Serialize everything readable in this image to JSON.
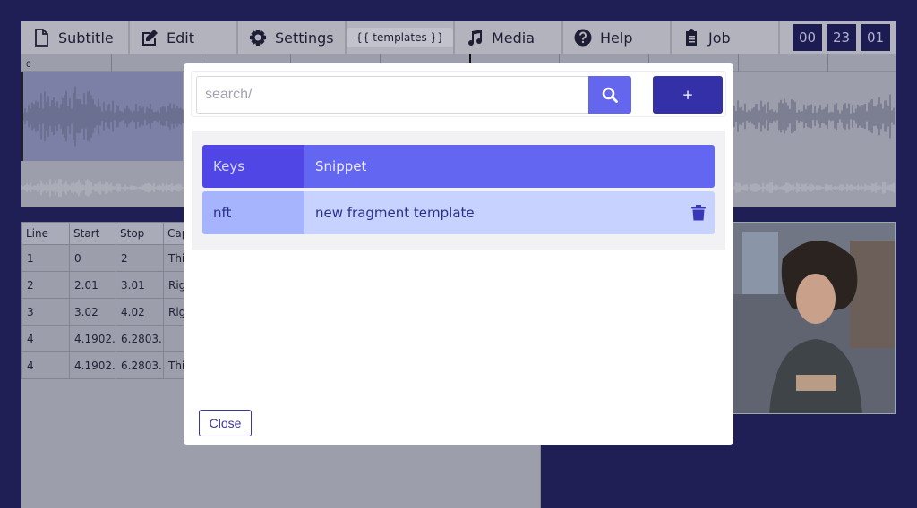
{
  "toolbar": {
    "subtitle": "Subtitle",
    "edit": "Edit",
    "settings": "Settings",
    "templates": "{{ templates }}",
    "media": "Media",
    "help": "Help",
    "job": "Job",
    "timer": [
      "00",
      "23",
      "01"
    ]
  },
  "waveform": {
    "ruler_start": "0"
  },
  "table": {
    "headers": [
      "Line",
      "Start",
      "Stop",
      "Cap"
    ],
    "rows": [
      [
        "1",
        "0",
        "2",
        "Thi"
      ],
      [
        "2",
        "2.01",
        "3.01",
        "Rig"
      ],
      [
        "3",
        "3.02",
        "4.02",
        "Rig"
      ],
      [
        "4",
        "4.1902.",
        "6.2803.",
        ""
      ],
      [
        "4",
        "4.1902.",
        "6.2803.",
        "Thi"
      ]
    ]
  },
  "modal": {
    "search_placeholder": "search/",
    "add_label": "+",
    "columns": {
      "keys": "Keys",
      "snippet": "Snippet"
    },
    "items": [
      {
        "key": "nft",
        "snippet": "new fragment template"
      }
    ],
    "close_label": "Close"
  },
  "colors": {
    "background": "#201f55",
    "accent": "#6366f1",
    "accent_dark": "#3430a8",
    "row_key": "#a5b4fc",
    "row_value": "#c7d2fe"
  }
}
